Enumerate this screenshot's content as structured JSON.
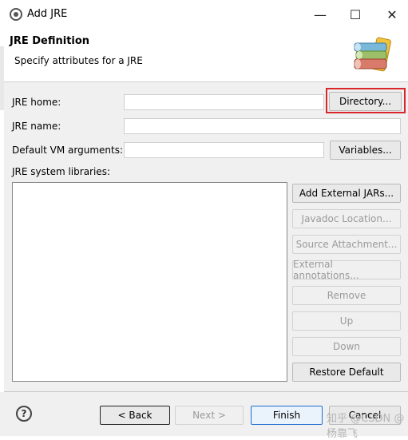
{
  "window": {
    "title": "Add JRE",
    "minimize_glyph": "—",
    "maximize_glyph": "☐",
    "close_glyph": "✕"
  },
  "banner": {
    "title": "JRE Definition",
    "description": "Specify attributes for a JRE"
  },
  "form": {
    "jre_home_label": "JRE home:",
    "jre_home_value": "",
    "directory_button": "Directory...",
    "jre_name_label": "JRE name:",
    "jre_name_value": "",
    "vm_args_label": "Default VM arguments:",
    "vm_args_value": "",
    "variables_button": "Variables...",
    "libraries_label": "JRE system libraries:"
  },
  "library_buttons": [
    {
      "label": "Add External JARs...",
      "enabled": true
    },
    {
      "label": "Javadoc Location...",
      "enabled": false
    },
    {
      "label": "Source Attachment...",
      "enabled": false
    },
    {
      "label": "External annotations...",
      "enabled": false
    },
    {
      "label": "Remove",
      "enabled": false
    },
    {
      "label": "Up",
      "enabled": false
    },
    {
      "label": "Down",
      "enabled": false
    },
    {
      "label": "Restore Default",
      "enabled": true
    }
  ],
  "footer": {
    "help_glyph": "?",
    "back_button": "< Back",
    "next_button": "Next >",
    "finish_button": "Finish",
    "cancel_button": "Cancel"
  },
  "watermark": "知乎 @CSDN @杨靠飞",
  "colors": {
    "highlight": "#d9262c",
    "primary_border": "#1f6fd1"
  }
}
